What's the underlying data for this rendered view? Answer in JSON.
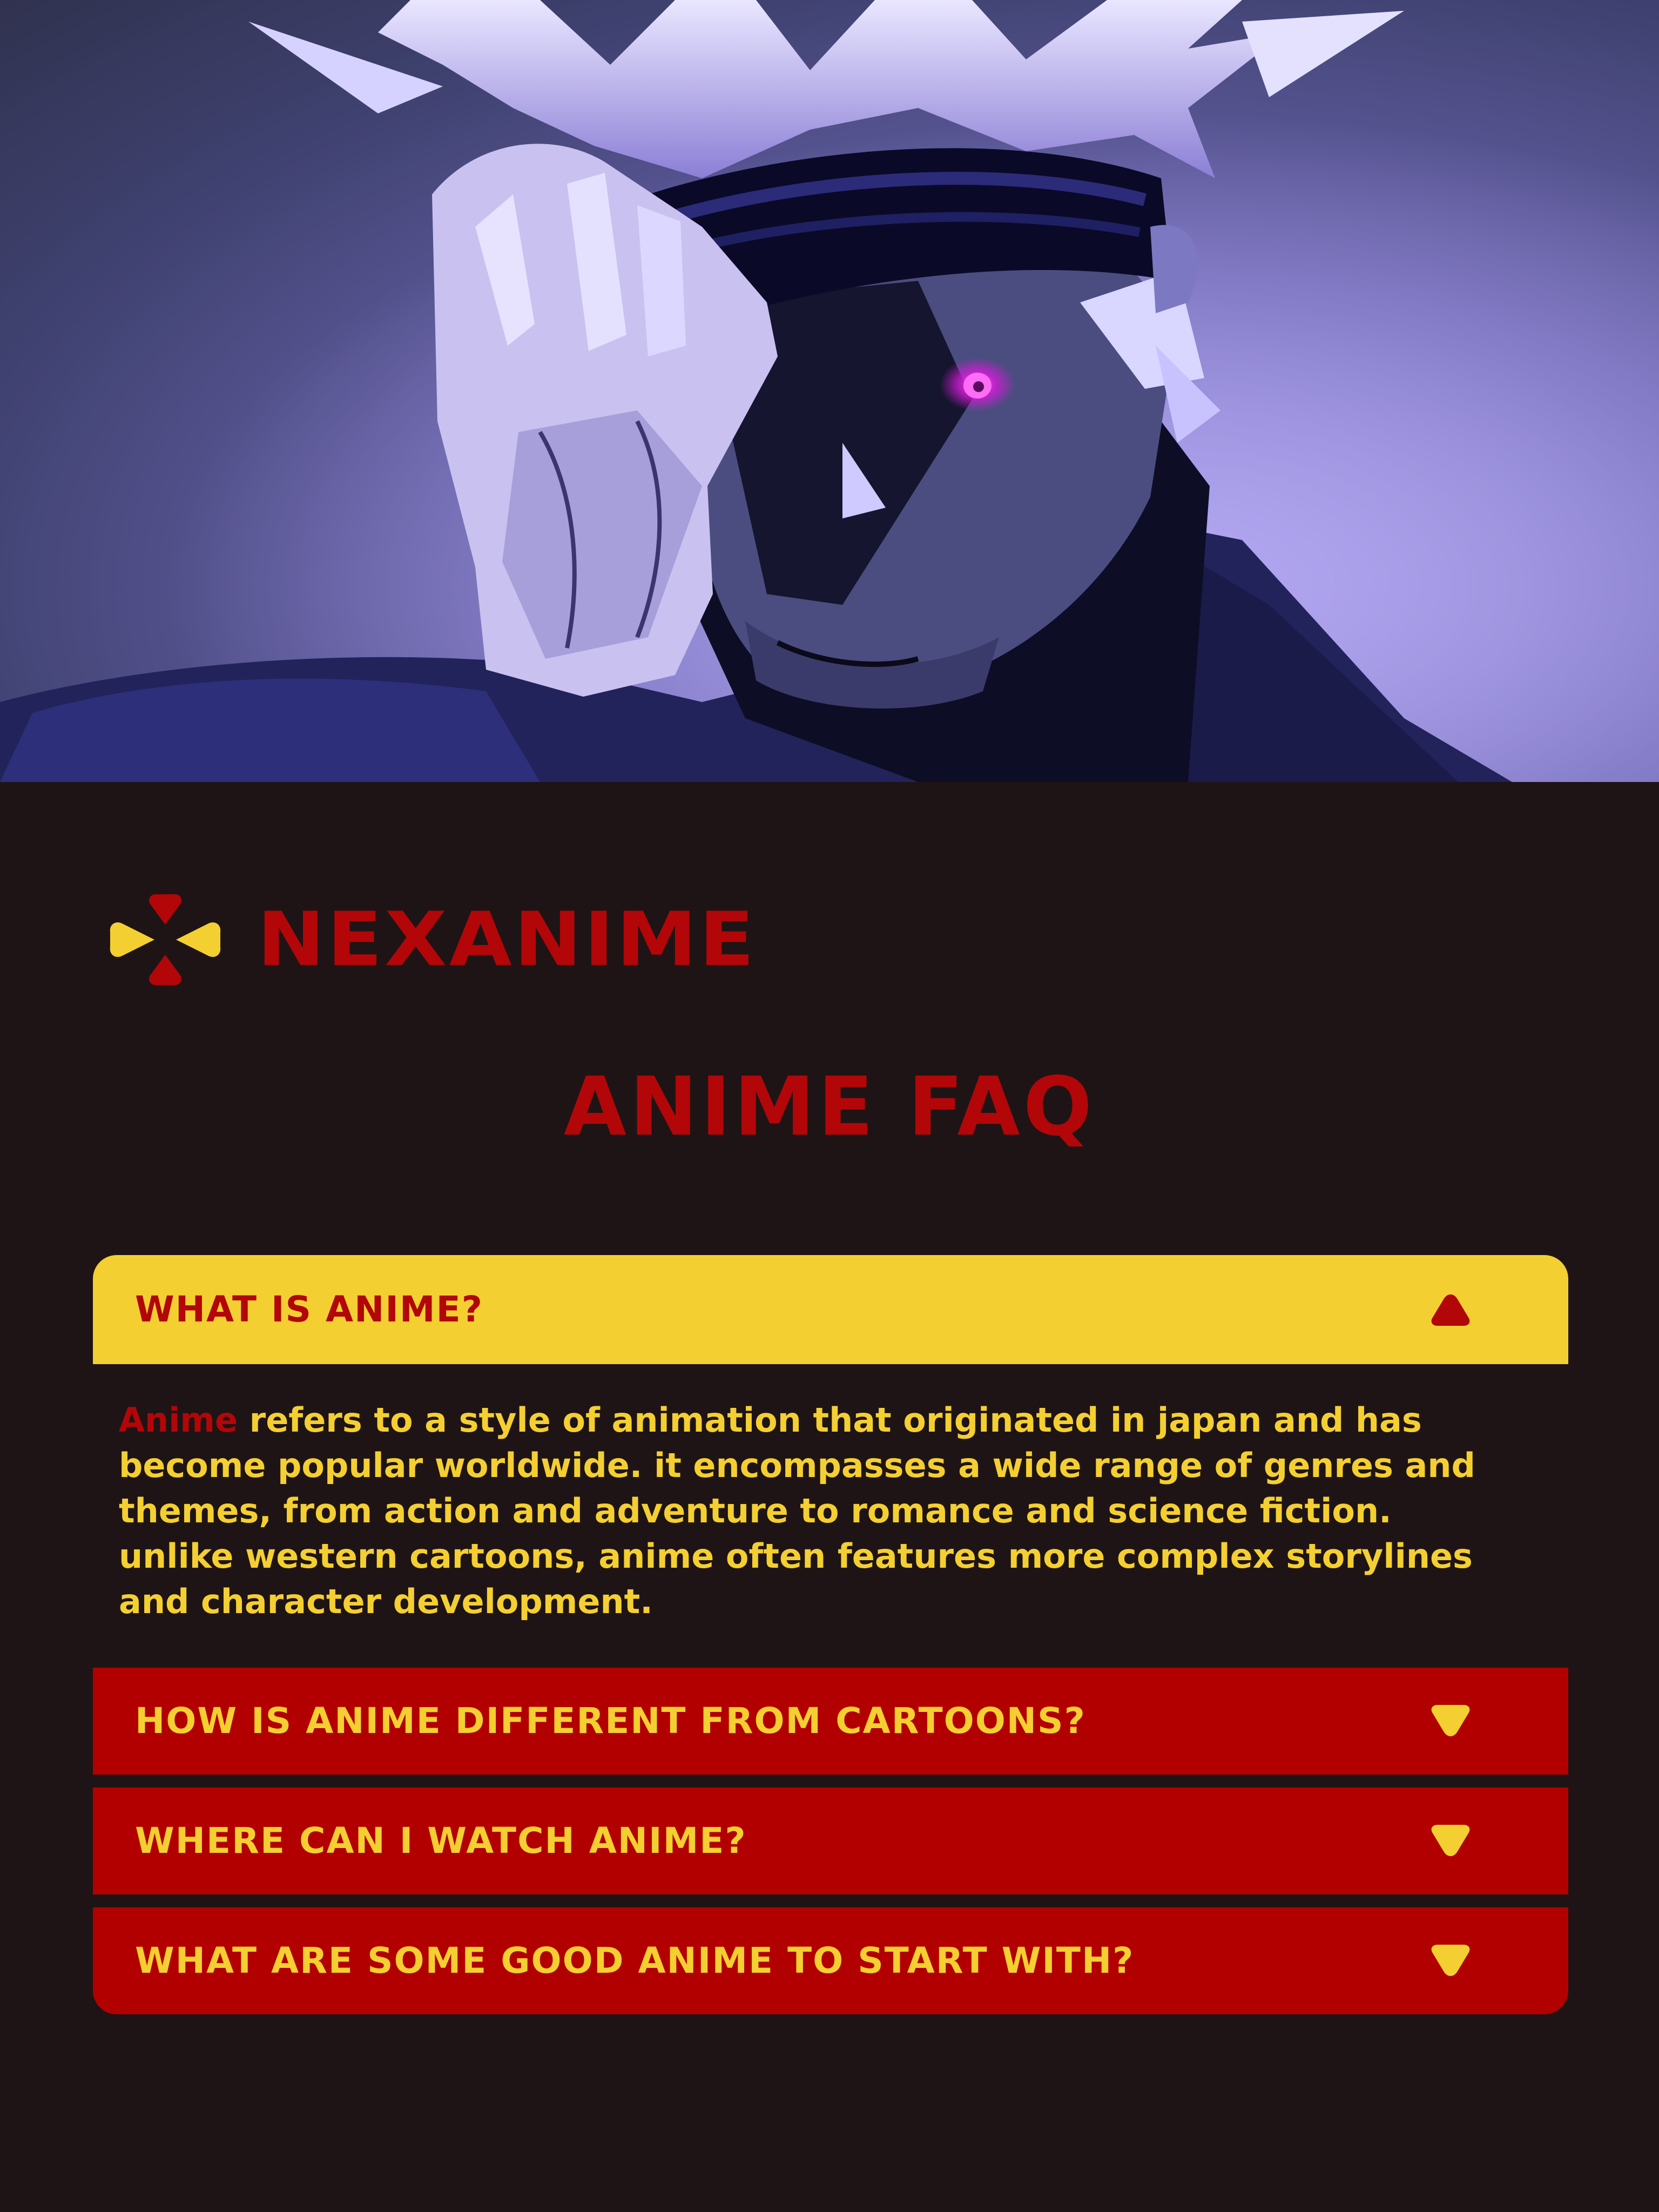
{
  "hero": {
    "image_alt": "Anime character with white spiky hair and dark blindfold, glowing magenta eye"
  },
  "brand": {
    "name": "NEXANIME",
    "icon": "nexanime-logo-icon"
  },
  "page": {
    "title": "ANIME FAQ"
  },
  "colors": {
    "background": "#1f1415",
    "red": "#b20608",
    "yellow": "#f4cf31"
  },
  "faq": {
    "items": [
      {
        "question": "WHAT IS ANIME?",
        "expanded": true,
        "answer_highlight": "Anime",
        "answer": " refers to a style of animation that originated in japan and has become popular worldwide. it encompasses a wide range of genres and themes, from action and adventure to romance and science fiction. unlike western cartoons, anime often features more complex storylines and character development."
      },
      {
        "question": "HOW IS ANIME DIFFERENT FROM CARTOONS?",
        "expanded": false
      },
      {
        "question": "WHERE CAN I WATCH ANIME?",
        "expanded": false
      },
      {
        "question": "WHAT ARE SOME GOOD ANIME TO START WITH?",
        "expanded": false
      }
    ]
  }
}
